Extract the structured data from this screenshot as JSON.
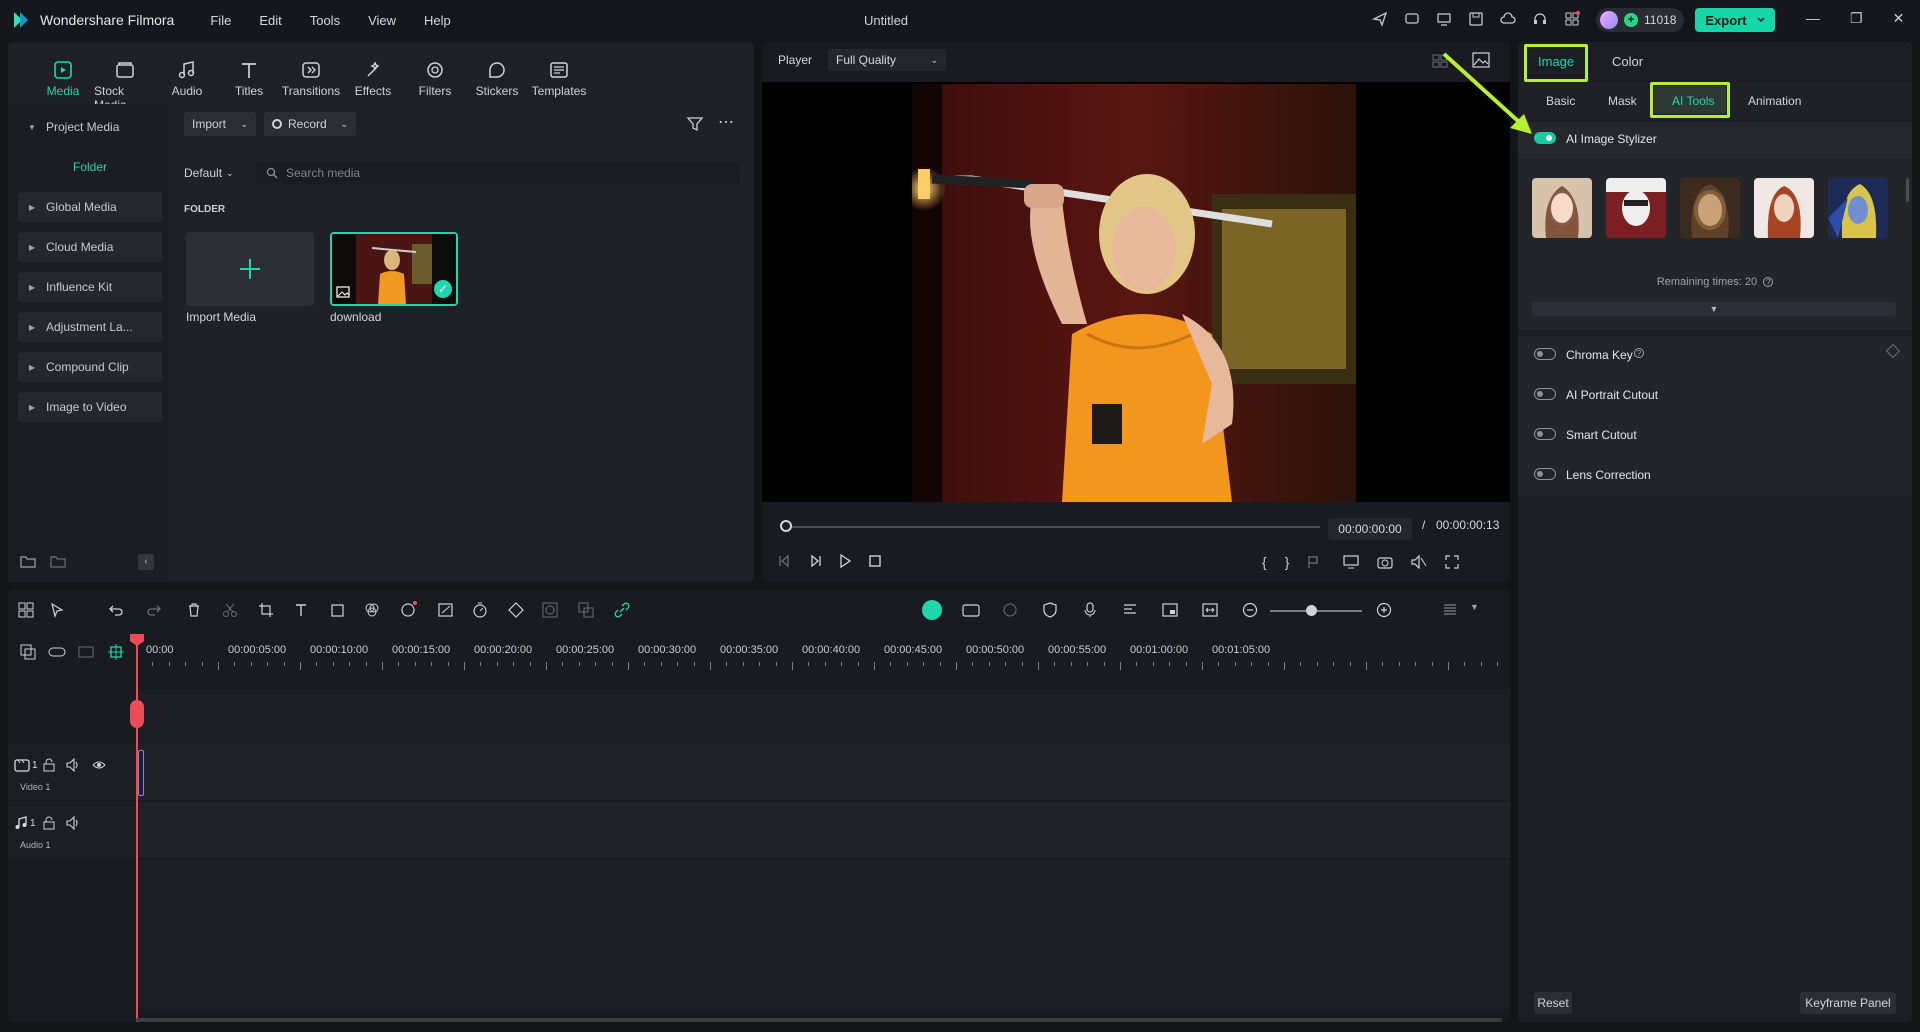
{
  "titlebar": {
    "app_name": "Wondershare Filmora",
    "menu": [
      "File",
      "Edit",
      "Tools",
      "View",
      "Help"
    ],
    "document_title": "Untitled",
    "credits": "11018",
    "export_label": "Export"
  },
  "media_tabs": [
    "Media",
    "Stock Media",
    "Audio",
    "Titles",
    "Transitions",
    "Effects",
    "Filters",
    "Stickers",
    "Templates"
  ],
  "media_tab_active": "Media",
  "tree": {
    "project_media": "Project Media",
    "folder": "Folder",
    "items": [
      "Global Media",
      "Cloud Media",
      "Influence Kit",
      "Adjustment La...",
      "Compound Clip",
      "Image to Video"
    ]
  },
  "library": {
    "import_label": "Import",
    "record_label": "Record",
    "sort_label": "Default",
    "search_placeholder": "Search media",
    "folder_heading": "FOLDER",
    "import_tile_label": "Import Media",
    "media_items": [
      {
        "name": "download"
      }
    ]
  },
  "player": {
    "label": "Player",
    "quality": "Full Quality",
    "current_time": "00:00:00:00",
    "separator": "/",
    "total_time": "00:00:00:13"
  },
  "properties": {
    "main_tabs": [
      "Image",
      "Color"
    ],
    "active_main_tab": "Image",
    "sub_tabs": [
      "Basic",
      "Mask",
      "AI Tools",
      "Animation"
    ],
    "active_sub_tab": "AI Tools",
    "stylizer": {
      "label": "AI Image Stylizer",
      "enabled": true,
      "remaining": "Remaining times: 20"
    },
    "options": [
      {
        "label": "Chroma Key",
        "enabled": false
      },
      {
        "label": "AI Portrait Cutout",
        "enabled": false
      },
      {
        "label": "Smart Cutout",
        "enabled": false
      },
      {
        "label": "Lens Correction",
        "enabled": false
      }
    ],
    "reset_label": "Reset",
    "keyframe_label": "Keyframe Panel"
  },
  "timeline": {
    "ruler": [
      "00:00",
      "00:00:05:00",
      "00:00:10:00",
      "00:00:15:00",
      "00:00:20:00",
      "00:00:25:00",
      "00:00:30:00",
      "00:00:35:00",
      "00:00:40:00",
      "00:00:45:00",
      "00:00:50:00",
      "00:00:55:00",
      "00:01:00:00",
      "00:01:05:00"
    ],
    "video_track": {
      "number": "1",
      "name": "Video 1"
    },
    "audio_track": {
      "number": "1",
      "name": "Audio 1"
    }
  },
  "colors": {
    "accent": "#1fd6ad",
    "highlight": "#b9ef32",
    "playhead": "#ef4a5a"
  }
}
